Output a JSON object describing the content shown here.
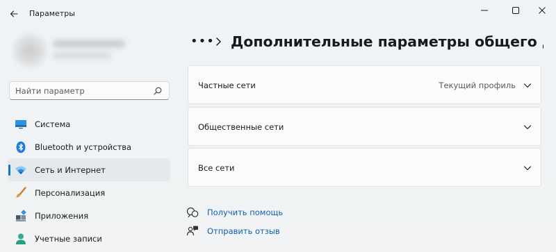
{
  "app": {
    "title": "Параметры"
  },
  "search": {
    "placeholder": "Найти параметр"
  },
  "sidebar": {
    "items": [
      {
        "label": "Система",
        "icon": "monitor-icon"
      },
      {
        "label": "Bluetooth и устройства",
        "icon": "bluetooth-icon"
      },
      {
        "label": "Сеть и Интернет",
        "icon": "wifi-icon",
        "active": true
      },
      {
        "label": "Персонализация",
        "icon": "brush-icon"
      },
      {
        "label": "Приложения",
        "icon": "apps-icon"
      },
      {
        "label": "Учетные записи",
        "icon": "account-icon"
      }
    ]
  },
  "main": {
    "breadcrumb_overflow": "•••",
    "title": "Дополнительные параметры общего дос",
    "cards": [
      {
        "label": "Частные сети",
        "status": "Текущий профиль"
      },
      {
        "label": "Общественные сети",
        "status": ""
      },
      {
        "label": "Все сети",
        "status": ""
      }
    ],
    "links": [
      {
        "label": "Получить помощь",
        "icon": "help-icon"
      },
      {
        "label": "Отправить отзыв",
        "icon": "feedback-icon"
      }
    ]
  },
  "colors": {
    "accent": "#1a73c7",
    "link": "#0f5fb3",
    "background": "#eff3f7"
  }
}
